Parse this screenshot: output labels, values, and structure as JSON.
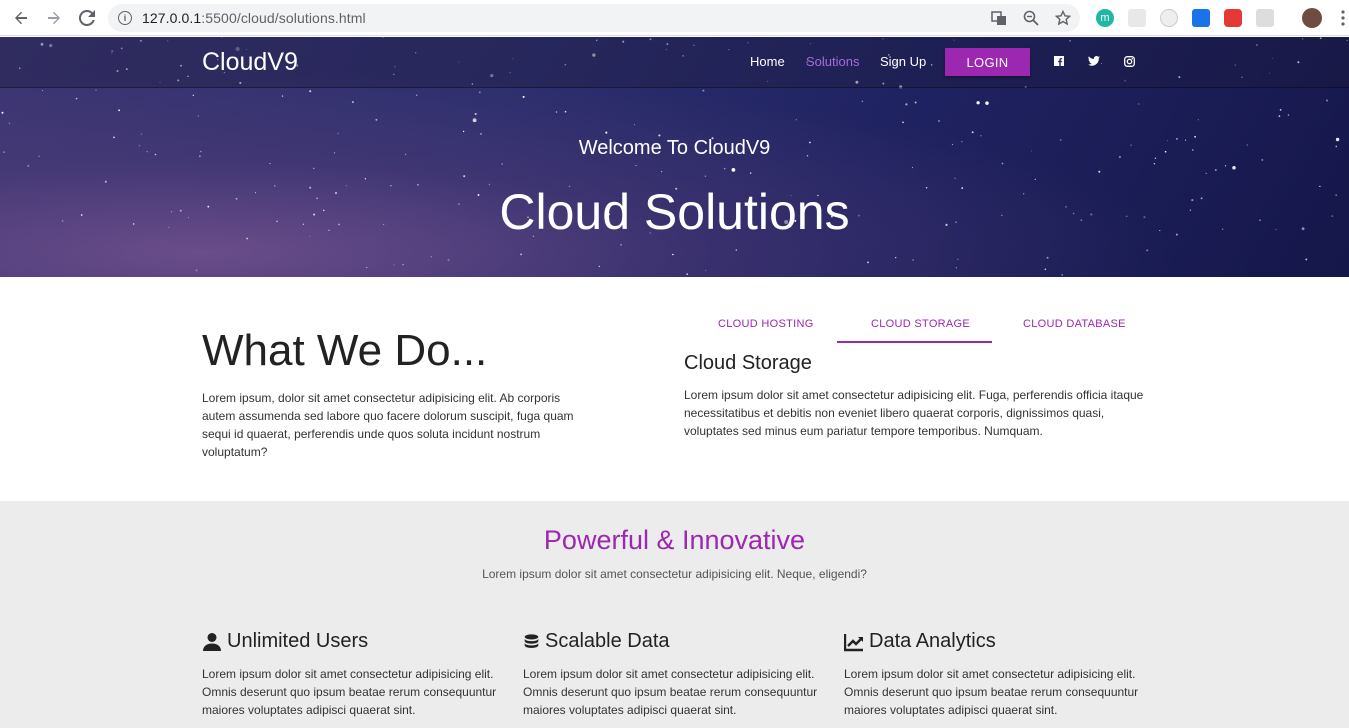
{
  "browser": {
    "url_host": "127.0.0.1",
    "url_path": ":5500/cloud/solutions.html"
  },
  "nav": {
    "brand": "CloudV9",
    "links": [
      "Home",
      "Solutions",
      "Sign Up"
    ],
    "login": "LOGIN"
  },
  "hero": {
    "subtitle": "Welcome To CloudV9",
    "title": "Cloud Solutions"
  },
  "what_we_do": {
    "title": "What We Do...",
    "text": "Lorem ipsum, dolor sit amet consectetur adipisicing elit. Ab corporis autem assumenda sed labore quo facere dolorum suscipit, fuga quam sequi id quaerat, perferendis unde quos soluta incidunt nostrum voluptatum?",
    "tabs": [
      "CLOUD HOSTING",
      "CLOUD STORAGE",
      "CLOUD DATABASE"
    ],
    "active_tab": "CLOUD STORAGE",
    "pane_title": "Cloud Storage",
    "pane_text": "Lorem ipsum dolor sit amet consectetur adipisicing elit. Fuga, perferendis officia itaque necessitatibus et debitis non eveniet libero quaerat corporis, dignissimos quasi, voluptates sed minus eum pariatur tempore temporibus. Numquam."
  },
  "powerful": {
    "title": "Powerful & Innovative",
    "subtitle": "Lorem ipsum dolor sit amet consectetur adipisicing elit. Neque, eligendi?",
    "features": [
      {
        "icon": "user-icon",
        "title": "Unlimited Users",
        "text": "Lorem ipsum dolor sit amet consectetur adipisicing elit. Omnis deserunt quo ipsum beatae rerum consequuntur maiores voluptates adipisci quaerat sint."
      },
      {
        "icon": "database-icon",
        "title": "Scalable Data",
        "text": "Lorem ipsum dolor sit amet consectetur adipisicing elit. Omnis deserunt quo ipsum beatae rerum consequuntur maiores voluptates adipisci quaerat sint."
      },
      {
        "icon": "chart-line-icon",
        "title": "Data Analytics",
        "text": "Lorem ipsum dolor sit amet consectetur adipisicing elit. Omnis deserunt quo ipsum beatae rerum consequuntur maiores voluptates adipisci quaerat sint."
      }
    ]
  },
  "colors": {
    "accent": "#9c27b0",
    "active_nav": "#a86bd8",
    "section_bg": "#ececec"
  }
}
